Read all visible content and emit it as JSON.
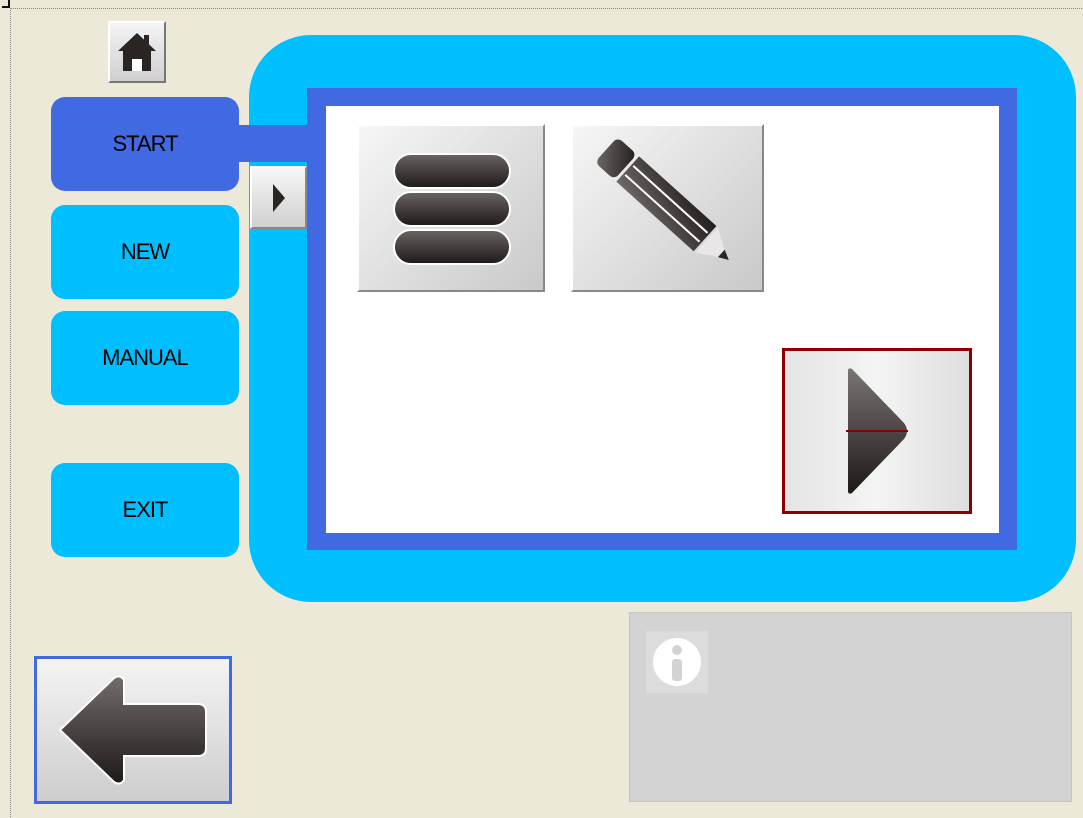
{
  "nav": {
    "home_icon": "home-icon",
    "items": [
      {
        "label": "START",
        "active": true
      },
      {
        "label": "NEW",
        "active": false
      },
      {
        "label": "MANUAL",
        "active": false
      },
      {
        "label": "EXIT",
        "active": false
      }
    ]
  },
  "content": {
    "expand_icon": "play-right-icon",
    "tiles": [
      {
        "icon": "list-icon"
      },
      {
        "icon": "pencil-icon"
      }
    ],
    "next_icon": "play-right-icon"
  },
  "footer": {
    "back_icon": "arrow-left-icon",
    "info_icon": "info-icon",
    "info_text": ""
  },
  "colors": {
    "background": "#ece9d8",
    "panel_outer": "#00bfff",
    "panel_inner": "#4169e1",
    "nav_active": "#4169e1",
    "nav_inactive": "#00bfff",
    "next_border": "#8b0000",
    "info_panel": "#d3d3d3"
  }
}
